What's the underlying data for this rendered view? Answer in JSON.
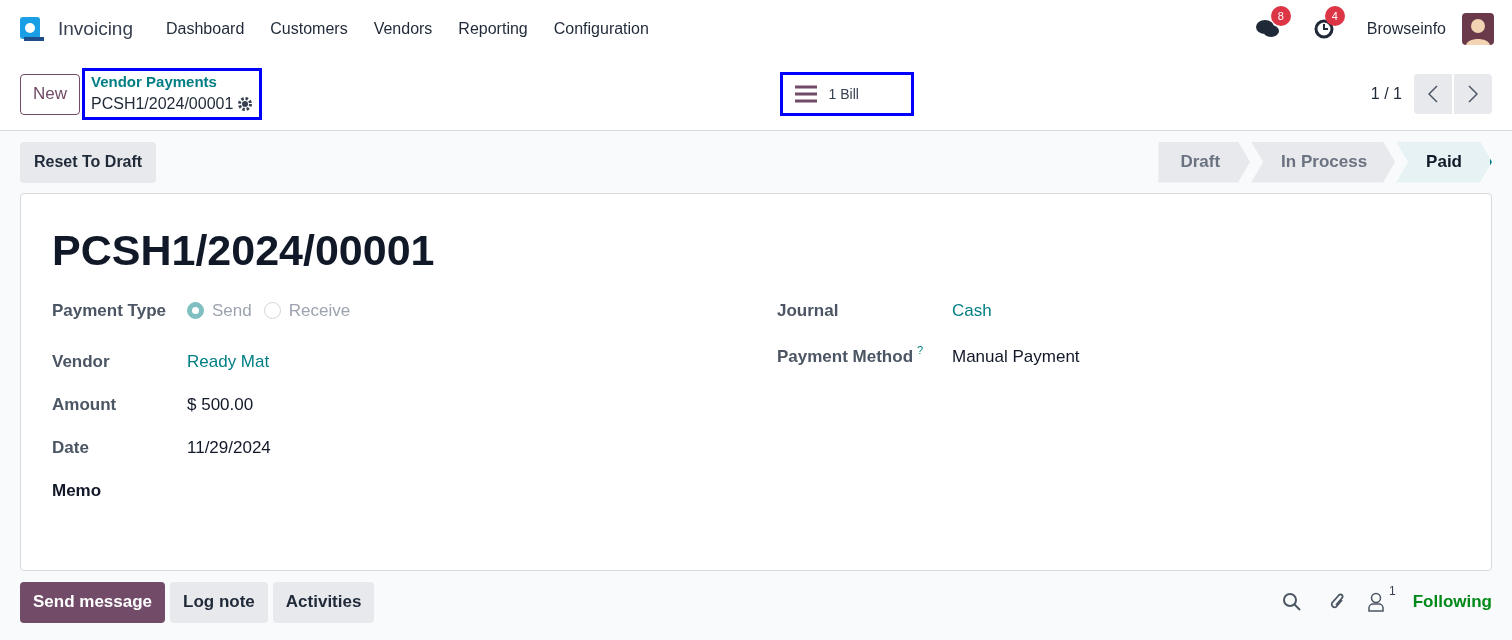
{
  "app": {
    "name": "Invoicing"
  },
  "menu": [
    "Dashboard",
    "Customers",
    "Vendors",
    "Reporting",
    "Configuration"
  ],
  "systray": {
    "messages_count": "8",
    "activities_count": "4",
    "user": "Browseinfo"
  },
  "control_panel": {
    "new_button": "New",
    "breadcrumb": "Vendor Payments",
    "record": "PCSH1/2024/00001",
    "smart_button": "1 Bill",
    "pager": "1 / 1"
  },
  "action_button": "Reset To Draft",
  "stages": [
    {
      "label": "Draft",
      "selected": false
    },
    {
      "label": "In Process",
      "selected": false
    },
    {
      "label": "Paid",
      "selected": true
    }
  ],
  "form": {
    "title": "PCSH1/2024/00001",
    "payment_type": {
      "label": "Payment Type",
      "options": [
        {
          "label": "Send",
          "selected": true
        },
        {
          "label": "Receive",
          "selected": false
        }
      ]
    },
    "left_fields": [
      {
        "label": "Vendor",
        "value": "Ready Mat",
        "kind": "link"
      },
      {
        "label": "Amount",
        "value": "$ 500.00",
        "kind": "text"
      },
      {
        "label": "Date",
        "value": "11/29/2024",
        "kind": "text"
      },
      {
        "label": "Memo",
        "kind": "heading"
      }
    ],
    "right_fields": [
      {
        "label": "Journal",
        "value": "Cash",
        "kind": "link"
      },
      {
        "label": "Payment Method",
        "help": "?",
        "value": "Manual Payment",
        "kind": "text"
      }
    ]
  },
  "chatter": {
    "buttons": [
      {
        "label": "Send message",
        "selected": true
      },
      {
        "label": "Log note",
        "selected": false
      },
      {
        "label": "Activities",
        "selected": false
      }
    ],
    "followers_count": "1",
    "following": "Following"
  }
}
